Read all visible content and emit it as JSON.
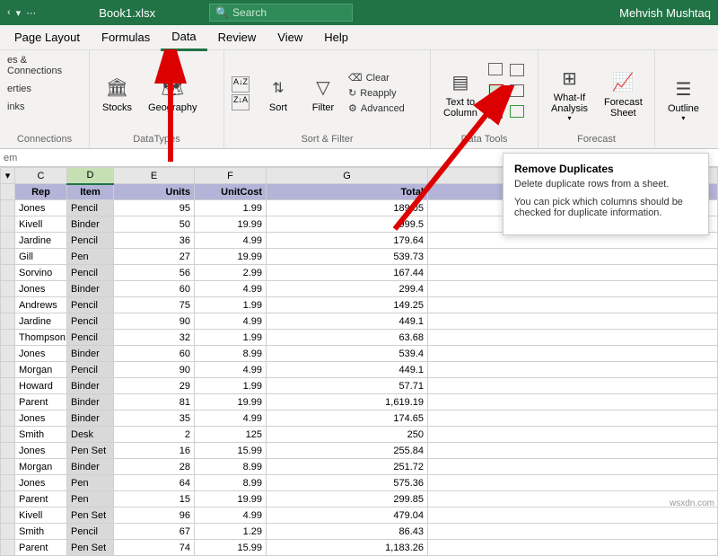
{
  "titlebar": {
    "filename": "Book1.xlsx",
    "search_placeholder": "Search",
    "user": "Mehvish Mushtaq"
  },
  "tabs": [
    "Page Layout",
    "Formulas",
    "Data",
    "Review",
    "View",
    "Help"
  ],
  "active_tab": "Data",
  "ribbon": {
    "queries": {
      "l1": "es & Connections",
      "l2": "erties",
      "l3": "inks",
      "label": "Connections"
    },
    "types": {
      "stocks": "Stocks",
      "geography": "Geography",
      "label": "DataTypes"
    },
    "sortfilter": {
      "sort": "Sort",
      "filter": "Filter",
      "clear": "Clear",
      "reapply": "Reapply",
      "advanced": "Advanced",
      "label": "Sort & Filter"
    },
    "datatools": {
      "text_to_columns": "Text to\nColumn",
      "label": "Data Tools"
    },
    "forecast": {
      "whatif": "What-If\nAnalysis",
      "sheet": "Forecast\nSheet",
      "label": "Forecast"
    },
    "outline": {
      "outline": "Outline"
    }
  },
  "formulabar": "em",
  "headers": {
    "C": "Rep",
    "D": "Item",
    "E": "Units",
    "F": "UnitCost",
    "G": "Total"
  },
  "rows": [
    {
      "rep": "Jones",
      "item": "Pencil",
      "units": 95,
      "cost": 1.99,
      "total": 189.05
    },
    {
      "rep": "Kivell",
      "item": "Binder",
      "units": 50,
      "cost": 19.99,
      "total": 999.5
    },
    {
      "rep": "Jardine",
      "item": "Pencil",
      "units": 36,
      "cost": 4.99,
      "total": "179.64"
    },
    {
      "rep": "Gill",
      "item": "Pen",
      "units": 27,
      "cost": 19.99,
      "total": 539.73
    },
    {
      "rep": "Sorvino",
      "item": "Pencil",
      "units": 56,
      "cost": 2.99,
      "total": 167.44
    },
    {
      "rep": "Jones",
      "item": "Binder",
      "units": 60,
      "cost": 4.99,
      "total": 299.4
    },
    {
      "rep": "Andrews",
      "item": "Pencil",
      "units": 75,
      "cost": 1.99,
      "total": 149.25
    },
    {
      "rep": "Jardine",
      "item": "Pencil",
      "units": 90,
      "cost": 4.99,
      "total": 449.1
    },
    {
      "rep": "Thompson",
      "item": "Pencil",
      "units": 32,
      "cost": 1.99,
      "total": 63.68
    },
    {
      "rep": "Jones",
      "item": "Binder",
      "units": 60,
      "cost": 8.99,
      "total": 539.4
    },
    {
      "rep": "Morgan",
      "item": "Pencil",
      "units": 90,
      "cost": 4.99,
      "total": 449.1
    },
    {
      "rep": "Howard",
      "item": "Binder",
      "units": 29,
      "cost": 1.99,
      "total": 57.71
    },
    {
      "rep": "Parent",
      "item": "Binder",
      "units": 81,
      "cost": 19.99,
      "total": "1,619.19"
    },
    {
      "rep": "Jones",
      "item": "Binder",
      "units": 35,
      "cost": 4.99,
      "total": 174.65
    },
    {
      "rep": "Smith",
      "item": "Desk",
      "units": 2,
      "cost": 125,
      "total": 250
    },
    {
      "rep": "Jones",
      "item": "Pen Set",
      "units": 16,
      "cost": 15.99,
      "total": 255.84
    },
    {
      "rep": "Morgan",
      "item": "Binder",
      "units": 28,
      "cost": 8.99,
      "total": 251.72
    },
    {
      "rep": "Jones",
      "item": "Pen",
      "units": 64,
      "cost": 8.99,
      "total": 575.36
    },
    {
      "rep": "Parent",
      "item": "Pen",
      "units": 15,
      "cost": 19.99,
      "total": 299.85
    },
    {
      "rep": "Kivell",
      "item": "Pen Set",
      "units": 96,
      "cost": 4.99,
      "total": 479.04
    },
    {
      "rep": "Smith",
      "item": "Pencil",
      "units": 67,
      "cost": 1.29,
      "total": 86.43
    },
    {
      "rep": "Parent",
      "item": "Pen Set",
      "units": 74,
      "cost": 15.99,
      "total": "1,183.26"
    }
  ],
  "tooltip": {
    "title": "Remove Duplicates",
    "desc1": "Delete duplicate rows from a sheet.",
    "desc2": "You can pick which columns should be checked for duplicate information."
  },
  "watermark": "wsxdn.com"
}
